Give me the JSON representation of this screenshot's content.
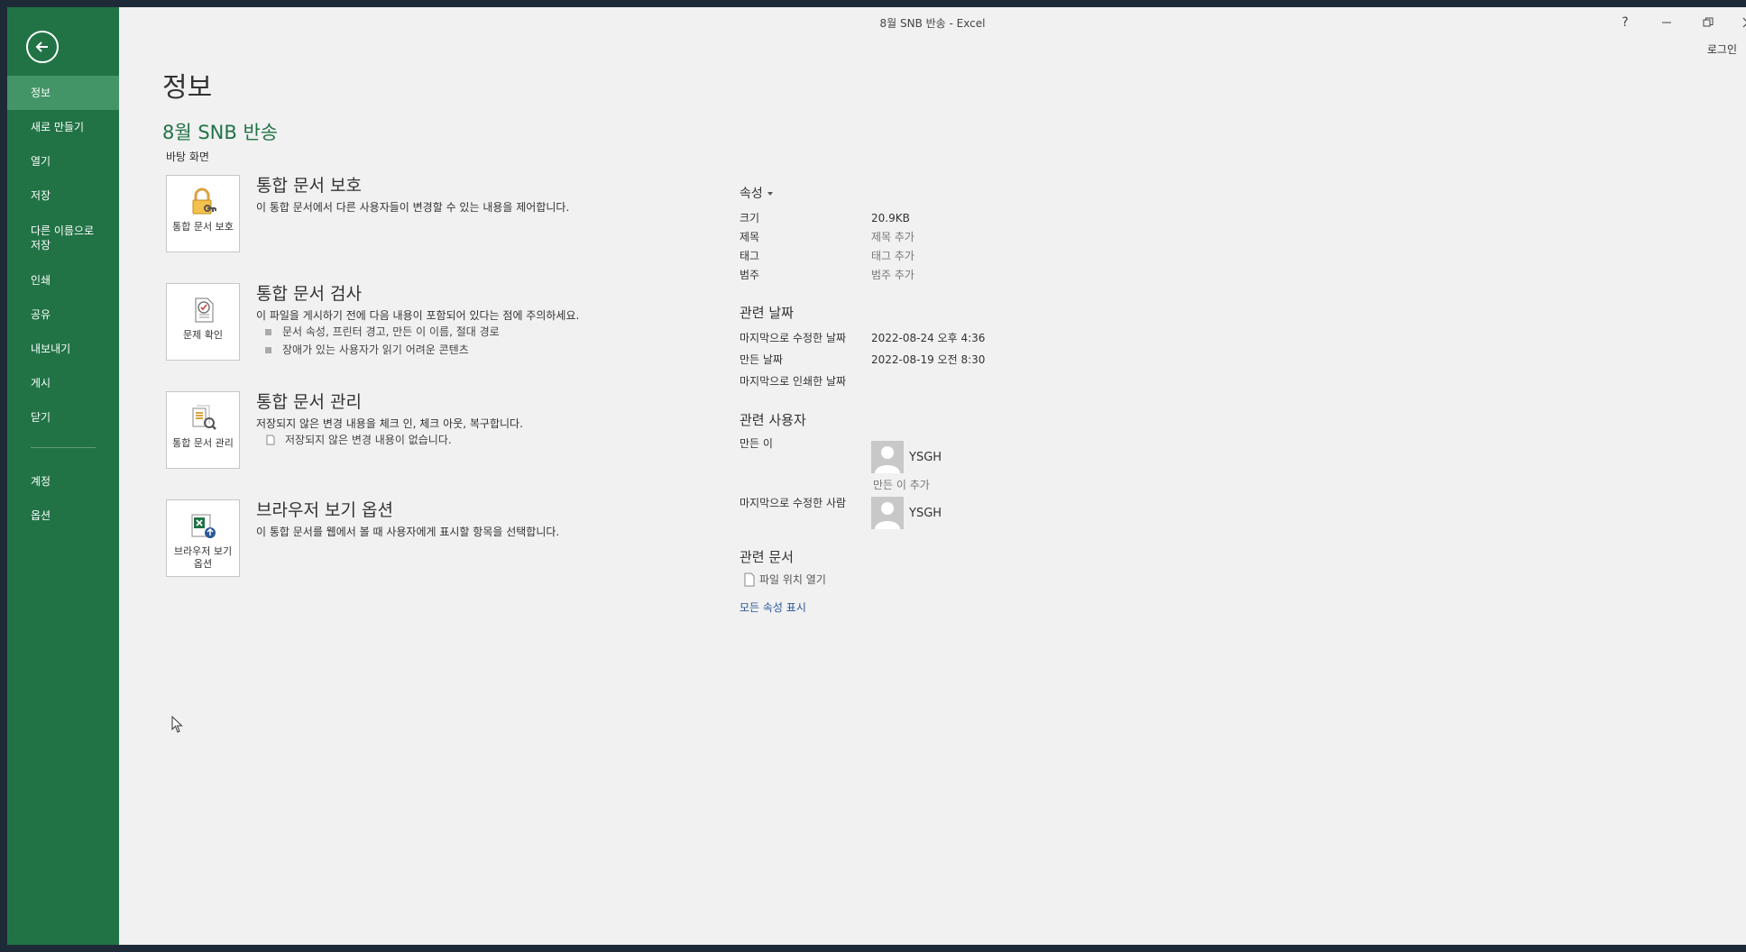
{
  "window": {
    "title": "8월 SNB 반송 - Excel",
    "help_label": "?",
    "login_label": "로그인"
  },
  "sidebar": {
    "items": [
      {
        "label": "정보"
      },
      {
        "label": "새로 만들기"
      },
      {
        "label": "열기"
      },
      {
        "label": "저장"
      },
      {
        "label": "다른 이름으로 저장"
      },
      {
        "label": "인쇄"
      },
      {
        "label": "공유"
      },
      {
        "label": "내보내기"
      },
      {
        "label": "게시"
      },
      {
        "label": "닫기"
      },
      {
        "label": "계정"
      },
      {
        "label": "옵션"
      }
    ]
  },
  "main": {
    "page_title": "정보",
    "doc_title": "8월 SNB 반송",
    "doc_location": "바탕 화면",
    "sections": [
      {
        "tile_label": "통합 문서 보호",
        "title": "통합 문서 보호",
        "desc": "이 통합 문서에서 다른 사용자들이 변경할 수 있는 내용을 제어합니다.",
        "icon": "lock-icon"
      },
      {
        "tile_label": "문제 확인",
        "title": "통합 문서 검사",
        "desc": "이 파일을 게시하기 전에 다음 내용이 포함되어 있다는 점에 주의하세요.",
        "bullets": [
          "문서 속성, 프린터 경고, 만든 이 이름, 절대 경로",
          "장애가 있는 사용자가 읽기 어려운 콘텐츠"
        ],
        "icon": "inspect-icon"
      },
      {
        "tile_label": "통합 문서 관리",
        "title": "통합 문서 관리",
        "desc": "저장되지 않은 변경 내용을 체크 인, 체크 아웃, 복구합니다.",
        "note": "저장되지 않은 변경 내용이 없습니다.",
        "icon": "manage-icon"
      },
      {
        "tile_label": "브라우저 보기 옵션",
        "title": "브라우저 보기 옵션",
        "desc": "이 통합 문서를 웹에서 볼 때 사용자에게 표시할 항목을 선택합니다.",
        "icon": "browser-view-icon"
      }
    ]
  },
  "properties": {
    "header": "속성",
    "rows": [
      {
        "key": "크기",
        "value": "20.9KB"
      },
      {
        "key": "제목",
        "value": "제목 추가"
      },
      {
        "key": "태그",
        "value": "태그 추가"
      },
      {
        "key": "범주",
        "value": "범주 추가"
      }
    ],
    "dates_header": "관련 날짜",
    "dates": [
      {
        "key": "마지막으로 수정한 날짜",
        "value": "2022-08-24 오후 4:36"
      },
      {
        "key": "만든 날짜",
        "value": "2022-08-19 오전 8:30"
      },
      {
        "key": "마지막으로 인쇄한 날짜",
        "value": ""
      }
    ],
    "people_header": "관련 사용자",
    "author_label": "만든 이",
    "author_name": "YSGH",
    "add_author": "만든 이 추가",
    "last_modified_by_label": "마지막으로 수정한 사람",
    "last_modified_by_name": "YSGH",
    "related_docs_header": "관련 문서",
    "open_file_location": "파일 위치 열기",
    "show_all": "모든 속성 표시"
  },
  "colors": {
    "accent": "#217346",
    "sidebar_active": "#439467",
    "link": "#2b5797"
  }
}
